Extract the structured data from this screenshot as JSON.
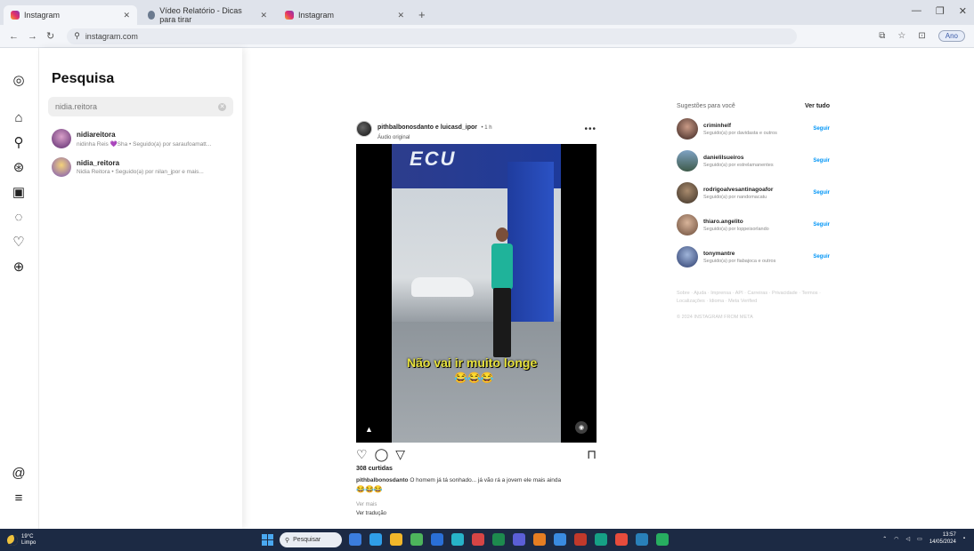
{
  "browser": {
    "tabs": [
      {
        "label": "Instagram",
        "icon": "instagram-icon",
        "active": true
      },
      {
        "label": "Vídeo Relatório - Dicas para tirar",
        "icon": "video-icon",
        "active": false
      },
      {
        "label": "Instagram",
        "icon": "instagram-icon",
        "active": false
      }
    ],
    "new_tab": "+",
    "url": "instagram.com",
    "profile_label": "Ano"
  },
  "sidebar": {
    "panel_title": "Pesquisa",
    "search_value": "nidia.reitora",
    "results": [
      {
        "username": "nidiareitora",
        "subtitle": "nidinha Reis 💜Sha • Seguido(a) por saraufoamatt..."
      },
      {
        "username": "nidia_reitora",
        "subtitle": "Nidia Reitora • Seguido(a) por nilan_jpor e mais..."
      }
    ]
  },
  "post": {
    "username": "pithbalbonosdanto e luicasd_ipor",
    "time": "• 1 h",
    "audio": "Áudio original",
    "video_brand": "ECU",
    "overlay_caption": "Não vai ir muito longe",
    "overlay_emoji": "😂😂😂",
    "likes": "308 curtidas",
    "caption_user": "pithbalbonosdanto",
    "caption_text": "O homem já tá sonhado... já vão rá a jovem ele mais ainda",
    "caption_emoji": "😂😂😂",
    "view_more": "Ver mais",
    "translate": "Ver tradução"
  },
  "suggestions": {
    "header": "Sugestões para você",
    "see_all": "Ver tudo",
    "follow_label": "Seguir",
    "items": [
      {
        "username": "criminhelf",
        "subtitle": "Seguido(a) por davidasta e outros"
      },
      {
        "username": "danielilsueiros",
        "subtitle": "Seguido(a) por estrelamanentes"
      },
      {
        "username": "rodrigoalvesantinagoafor",
        "subtitle": "Seguido(a) por nandomacatu"
      },
      {
        "username": "thiaro.angelito",
        "subtitle": "Seguido(a) por loppeisorlando"
      },
      {
        "username": "tonymantre",
        "subtitle": "Seguido(a) por fiabajoca e outros"
      }
    ],
    "footer_links": "Sobre · Ajuda · Imprensa · API · Carreiras · Privacidade · Termos · Localizações · Idioma · Meta Verified",
    "copyright": "© 2024 INSTAGRAM FROM META"
  },
  "taskbar": {
    "weather_temp": "19°C",
    "weather_desc": "Limpo",
    "search_label": "Pesquisar",
    "time": "13:57",
    "date": "14/05/2024"
  }
}
